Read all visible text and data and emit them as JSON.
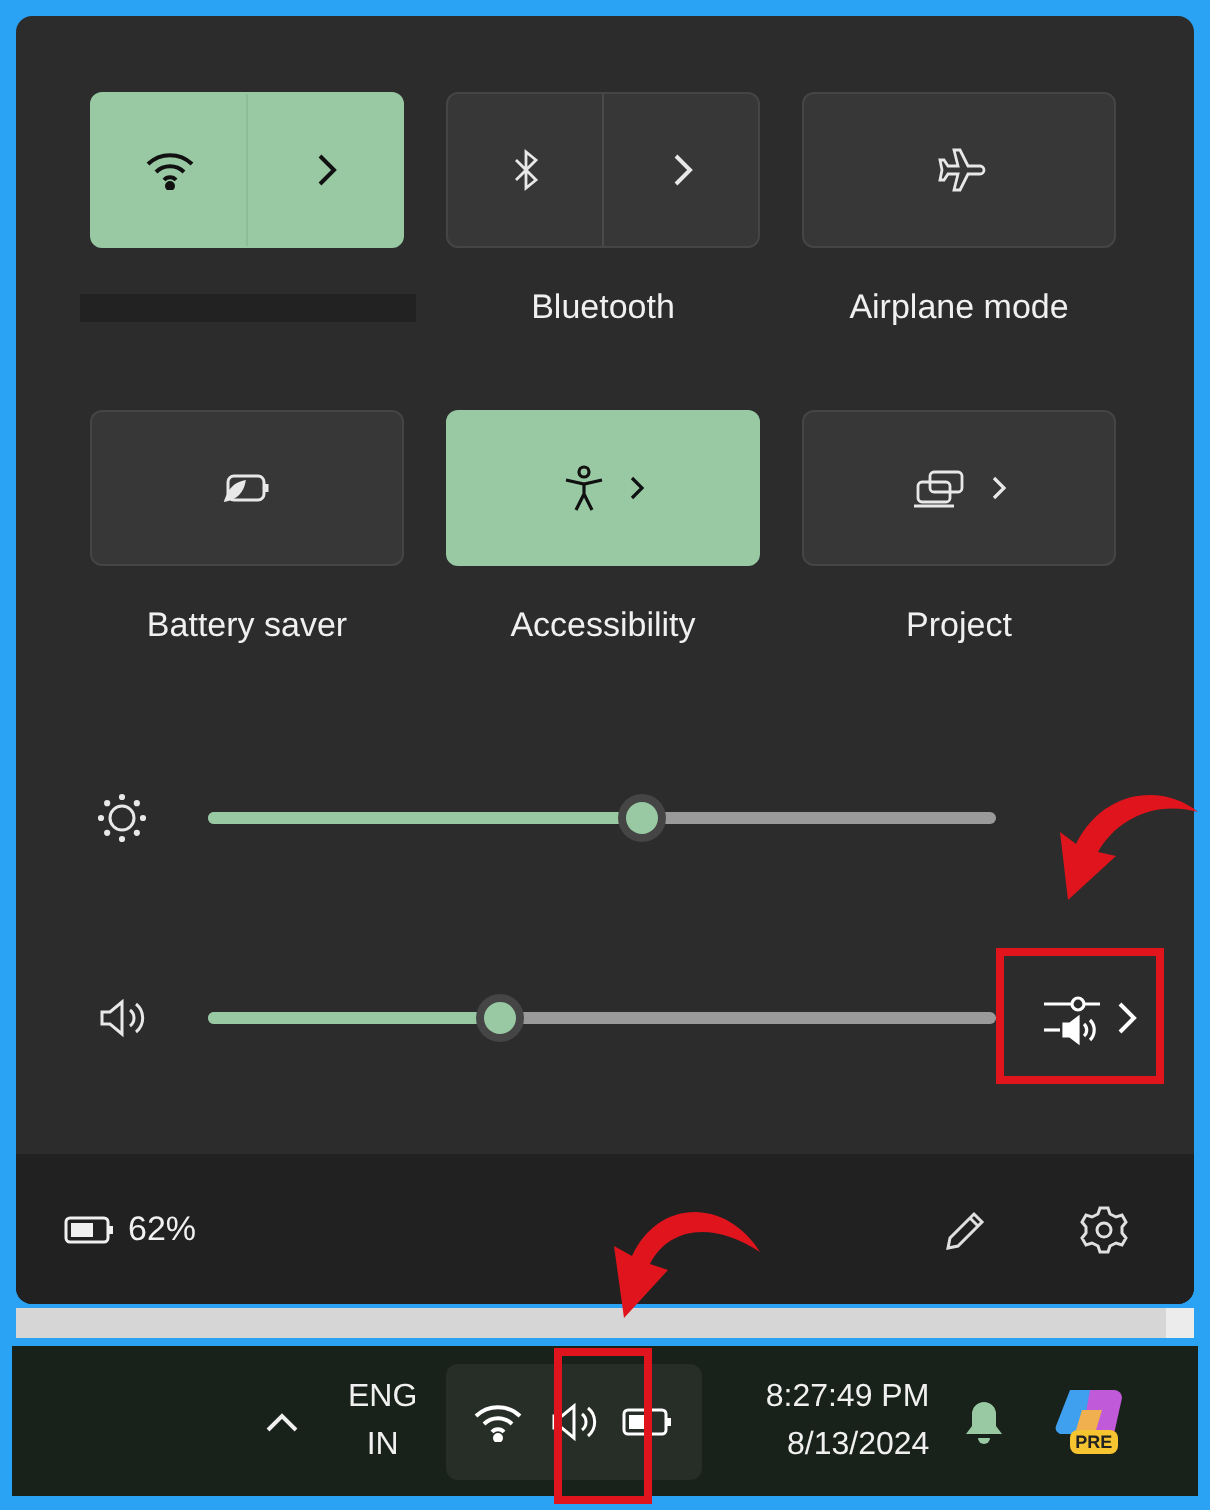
{
  "tiles": [
    {
      "kind": "split",
      "on": true
    },
    {
      "kind": "split",
      "on": false,
      "label": "Bluetooth"
    },
    {
      "kind": "single",
      "on": false,
      "label": "Airplane mode"
    },
    {
      "kind": "single",
      "on": false,
      "label": "Battery saver"
    },
    {
      "kind": "chevron",
      "on": true,
      "label": "Accessibility"
    },
    {
      "kind": "chevron",
      "on": false,
      "label": "Project"
    }
  ],
  "sliders": [
    {
      "kind": "brightness",
      "level": 0.55
    },
    {
      "kind": "volume",
      "level": 0.37
    }
  ],
  "footer": {
    "battery": "62%"
  },
  "taskbar": {
    "language": "ENG",
    "region": "IN",
    "time": "8:27:49 PM",
    "date": "8/13/2024",
    "copilot_badge": "PRE"
  }
}
